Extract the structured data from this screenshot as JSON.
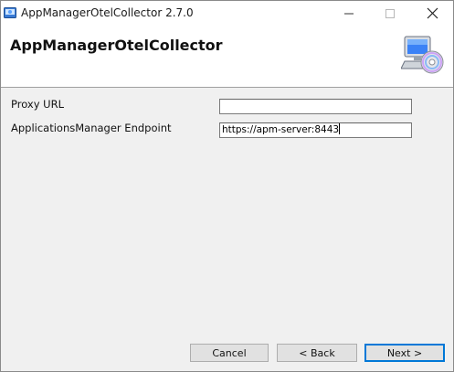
{
  "window": {
    "title": "AppManagerOtelCollector 2.7.0",
    "app_icon": "installer-app-icon",
    "controls": {
      "minimize_icon": "minimize-icon",
      "maximize_icon": "maximize-icon",
      "close_icon": "close-icon"
    }
  },
  "header": {
    "title": "AppManagerOtelCollector",
    "icon": "computer-cd-install-icon"
  },
  "form": {
    "proxy_url": {
      "label": "Proxy URL",
      "value": ""
    },
    "endpoint": {
      "label": "ApplicationsManager Endpoint",
      "value": "https://apm-server:8443"
    }
  },
  "buttons": {
    "cancel": "Cancel",
    "back": "< Back",
    "next": "Next >"
  },
  "colors": {
    "accent": "#0078d7",
    "window_bg": "#f0f0f0",
    "header_bg": "#ffffff"
  }
}
